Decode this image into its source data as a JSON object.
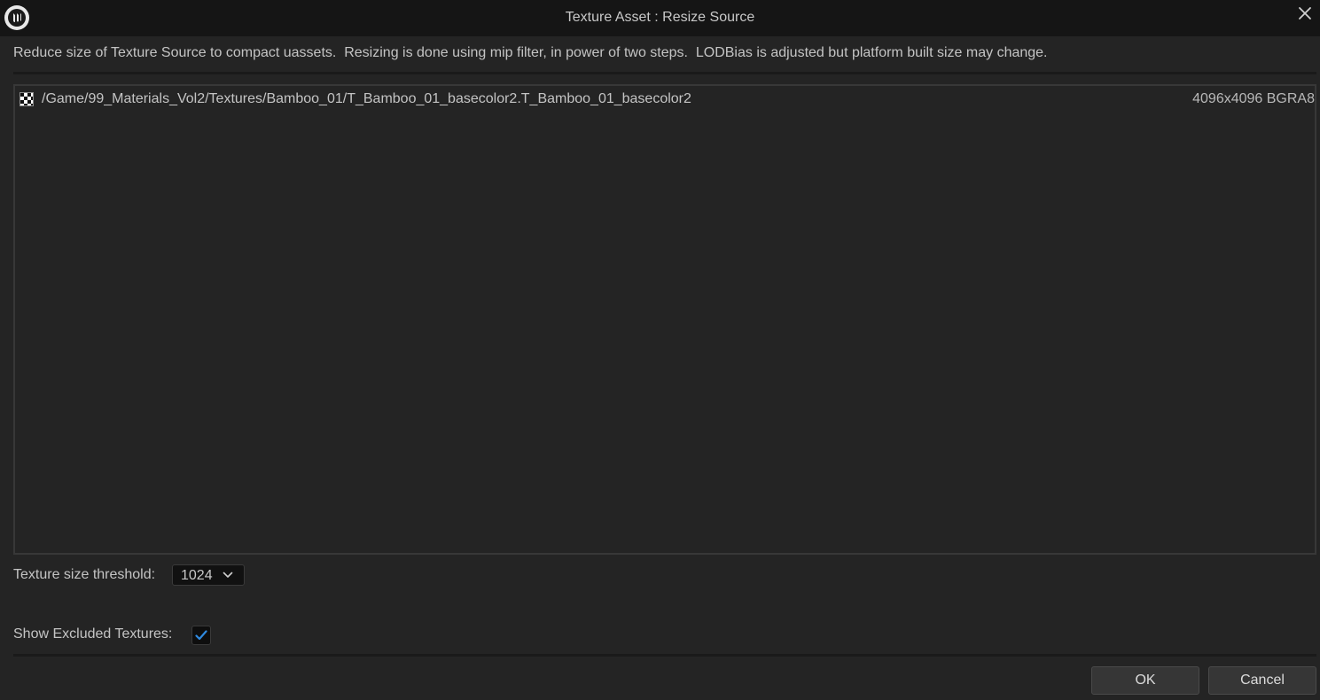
{
  "window": {
    "title": "Texture Asset : Resize Source",
    "logo_icon": "unreal-engine-logo",
    "close_icon": "close-icon"
  },
  "description": "Reduce size of Texture Source to compact uassets.  Resizing is done using mip filter, in power of two steps.  LODBias is adjusted but platform built size may change.",
  "texture_list": {
    "items": [
      {
        "icon": "texture-checker-icon",
        "path": "/Game/99_Materials_Vol2/Textures/Bamboo_01/T_Bamboo_01_basecolor2.T_Bamboo_01_basecolor2",
        "size_format": "4096x4096 BGRA8"
      }
    ]
  },
  "threshold": {
    "label": "Texture size threshold:",
    "selected": "1024"
  },
  "show_excluded": {
    "label": "Show Excluded Textures:",
    "checked": true
  },
  "buttons": {
    "ok": "OK",
    "cancel": "Cancel"
  },
  "colors": {
    "background": "#242424",
    "titlebar": "#151515",
    "accent": "#2f8ae0",
    "text": "#c4c4c4"
  }
}
